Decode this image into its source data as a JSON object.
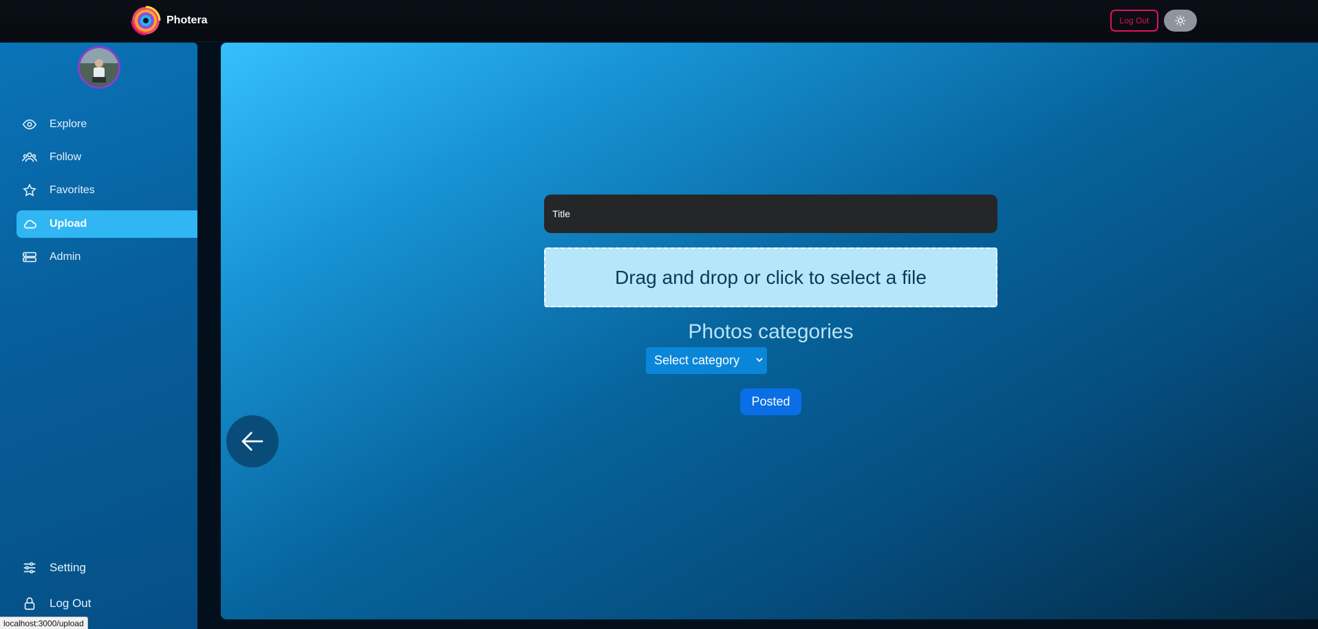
{
  "header": {
    "brand_name": "Photera",
    "logout_label": "Log Out",
    "theme_toggle_icon": "sun-icon"
  },
  "sidebar": {
    "items": [
      {
        "label": "Explore",
        "icon": "eye-icon",
        "active": false
      },
      {
        "label": "Follow",
        "icon": "users-icon",
        "active": false
      },
      {
        "label": "Favorites",
        "icon": "star-icon",
        "active": false
      },
      {
        "label": "Upload",
        "icon": "cloud-icon",
        "active": true
      },
      {
        "label": "Admin",
        "icon": "database-icon",
        "active": false
      }
    ],
    "bottom_items": [
      {
        "label": "Setting",
        "icon": "sliders-icon"
      },
      {
        "label": "Log Out",
        "icon": "lock-icon"
      }
    ]
  },
  "upload_form": {
    "title_placeholder": "Title",
    "dropzone_text": "Drag and drop or click to select a file",
    "categories_heading": "Photos categories",
    "category_selected": "Select category",
    "submit_label": "Posted"
  },
  "status_bar": {
    "url": "localhost:3000/upload"
  },
  "colors": {
    "accent": "#2fb6f3",
    "logout_border": "#e0115f",
    "button_blue": "#0a6fe6"
  }
}
